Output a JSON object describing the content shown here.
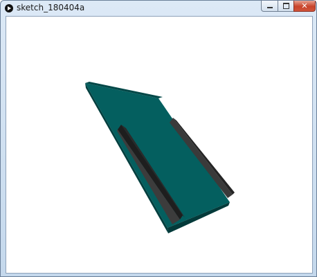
{
  "window": {
    "title": "sketch_180404a",
    "controls": {
      "minimize_icon": "minimize-icon",
      "maximize_icon": "restore-icon",
      "close_icon": "close-icon",
      "close_glyph": "✕"
    }
  },
  "scene": {
    "colors": {
      "background": "#ffffff",
      "board_top": "#045f5f",
      "board_edge": "#033f3f",
      "rail_face": "#3c3c3c",
      "rail_side": "#1e1e1e"
    }
  }
}
